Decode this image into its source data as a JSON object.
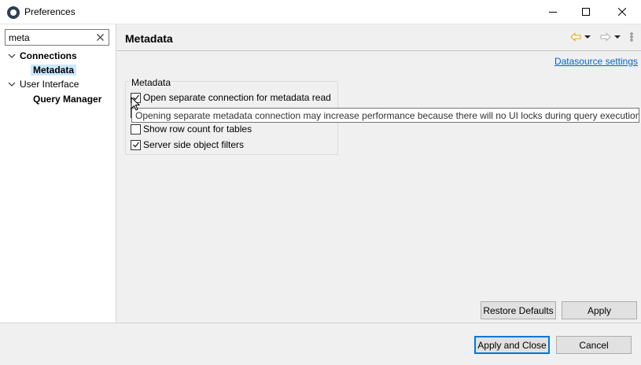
{
  "window": {
    "title": "Preferences",
    "icon": "dbeaver-icon",
    "controls": [
      "minimize-icon",
      "maximize-icon",
      "close-icon"
    ]
  },
  "filter": {
    "value": "meta",
    "clear_icon": "clear-icon"
  },
  "tree": [
    {
      "label": "Connections",
      "expanded": true,
      "bold": true
    },
    {
      "label": "Metadata",
      "bold": true,
      "selected": true
    },
    {
      "label": "User Interface",
      "expanded": true,
      "bold": false
    },
    {
      "label": "Query Manager",
      "bold": true
    }
  ],
  "page": {
    "title": "Metadata",
    "datasource_link": "Datasource settings",
    "group_label": "Metadata",
    "options": [
      {
        "label": "Open separate connection for metadata read",
        "checked": true
      },
      {
        "label": "",
        "checked": false
      },
      {
        "label": "Show row count for tables",
        "checked": false
      },
      {
        "label": "Server side object filters",
        "checked": true
      }
    ],
    "tooltip": "Opening separate metadata connection may increase performance because there will no UI locks during query execution"
  },
  "buttons": {
    "restore_defaults": "Restore Defaults",
    "apply": "Apply",
    "apply_and_close": "Apply and Close",
    "cancel": "Cancel"
  },
  "colors": {
    "selection": "#cce8ff",
    "link": "#0066cc",
    "default_button_border": "#0078d7",
    "nav_arrow": "#e8a200"
  }
}
